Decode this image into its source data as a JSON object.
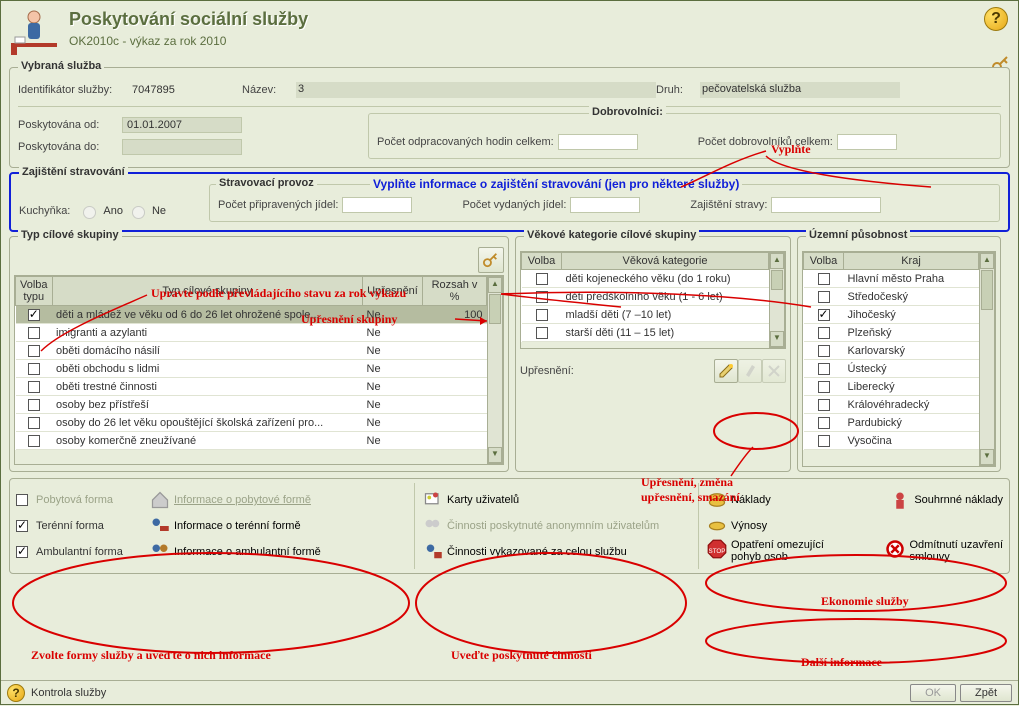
{
  "header": {
    "title": "Poskytování sociální služby",
    "subtitle": "OK2010c - výkaz za rok 2010",
    "help": "?"
  },
  "vybranaSluzba": {
    "title": "Vybraná služba",
    "identLabel": "Identifikátor služby:",
    "identValue": "7047895",
    "nazevLabel": "Název:",
    "nazevValue": "3",
    "druhLabel": "Druh:",
    "druhValue": "pečovatelská služba",
    "odLabel": "Poskytována od:",
    "odValue": "01.01.2007",
    "doLabel": "Poskytována do:",
    "doValue": "",
    "dobroBoxLabel": "Dobrovolníci:",
    "hodinLabel": "Počet odpracovaných hodin celkem:",
    "hodinValue": "",
    "pocetDobroLabel": "Počet dobrovolníků celkem:",
    "pocetDobroValue": ""
  },
  "annotations": {
    "vyplnte": "Vyplňte",
    "strav": "Vyplňte informace o zajištění stravování (jen pro některé služby)",
    "upravte": "Upravte podle převládajícího stavu za rok výkazu",
    "upresSkupiny": "Upřesnění skupiny",
    "zmenaSmazani1": "Upřesnění, změna",
    "zmenaSmazani2": "upřesnění, smazání",
    "zvolteFormy": "Zvolte formy služby a uveďte o nich informace",
    "uvedteCinnosti": "Uveďte poskytnuté činnosti",
    "ekonomie": "Ekonomie služby",
    "dalsi": "Další informace"
  },
  "stravovani": {
    "title": "Zajištění stravování",
    "kuchynkaLabel": "Kuchyňka:",
    "ano": "Ano",
    "ne": "Ne",
    "provozTitle": "Stravovací provoz",
    "jidelLabel": "Počet připravených jídel:",
    "vydanychLabel": "Počet vydaných jídel:",
    "zajisteniLabel": "Zajištění stravy:"
  },
  "typSkupiny": {
    "title": "Typ cílové skupiny",
    "cols": {
      "volba": "Volba typu",
      "typ": "Typ cílové skupiny",
      "upres": "Upřesnění",
      "rozsah": "Rozsah v %"
    },
    "rows": [
      {
        "chk": true,
        "typ": "děti a mládež ve věku od 6 do 26 let ohrožené spole...",
        "upres": "Ne",
        "rozsah": "100"
      },
      {
        "chk": false,
        "typ": "imigranti a azylanti",
        "upres": "Ne",
        "rozsah": ""
      },
      {
        "chk": false,
        "typ": "oběti domácího násilí",
        "upres": "Ne",
        "rozsah": ""
      },
      {
        "chk": false,
        "typ": "oběti obchodu s lidmi",
        "upres": "Ne",
        "rozsah": ""
      },
      {
        "chk": false,
        "typ": "oběti trestné činnosti",
        "upres": "Ne",
        "rozsah": ""
      },
      {
        "chk": false,
        "typ": "osoby bez přístřeší",
        "upres": "Ne",
        "rozsah": ""
      },
      {
        "chk": false,
        "typ": "osoby do 26 let věku opouštějící školská zařízení pro...",
        "upres": "Ne",
        "rozsah": ""
      },
      {
        "chk": false,
        "typ": "osoby komerčně zneužívané",
        "upres": "Ne",
        "rozsah": ""
      }
    ]
  },
  "vekove": {
    "title": "Věkové kategorie cílové skupiny",
    "cols": {
      "volba": "Volba",
      "kat": "Věková kategorie"
    },
    "rows": [
      {
        "chk": false,
        "kat": "děti kojeneckého věku (do 1 roku)"
      },
      {
        "chk": false,
        "kat": "děti předškolního věku (1 - 6 let)"
      },
      {
        "chk": false,
        "kat": "mladší děti (7 –10 let)"
      },
      {
        "chk": false,
        "kat": "starší děti (11 – 15 let)"
      }
    ],
    "upresLabel": "Upřesnění:"
  },
  "uzemni": {
    "title": "Územní působnost",
    "cols": {
      "volba": "Volba",
      "kraj": "Kraj"
    },
    "rows": [
      {
        "chk": false,
        "kraj": "Hlavní město Praha"
      },
      {
        "chk": false,
        "kraj": "Středočeský"
      },
      {
        "chk": true,
        "kraj": "Jihočeský"
      },
      {
        "chk": false,
        "kraj": "Plzeňský"
      },
      {
        "chk": false,
        "kraj": "Karlovarský"
      },
      {
        "chk": false,
        "kraj": "Ústecký"
      },
      {
        "chk": false,
        "kraj": "Liberecký"
      },
      {
        "chk": false,
        "kraj": "Královéhradecký"
      },
      {
        "chk": false,
        "kraj": "Pardubický"
      },
      {
        "chk": false,
        "kraj": "Vysočina"
      }
    ]
  },
  "formy": {
    "pobytova": {
      "label": "Pobytová forma",
      "info": "Informace o pobytové formě"
    },
    "terenni": {
      "label": "Terénní forma",
      "info": "Informace o terénní formě"
    },
    "ambulant": {
      "label": "Ambulantní forma",
      "info": "Informace o ambulantní formě"
    }
  },
  "cinnosti": {
    "karty": "Karty uživatelů",
    "anonym": "Činnosti poskytnuté anonymním uživatelům",
    "celou": "Činnosti vykazované za celou službu"
  },
  "ekon": {
    "naklady": "Náklady",
    "vynosy": "Výnosy",
    "souhrnne": "Souhrnné náklady",
    "opatreni1": "Opatření omezující",
    "opatreni2": "pohyb osob",
    "odmit1": "Odmítnutí uzavření",
    "odmit2": "smlouvy"
  },
  "footer": {
    "kontrola": "Kontrola služby",
    "ok": "OK",
    "zpet": "Zpět"
  }
}
